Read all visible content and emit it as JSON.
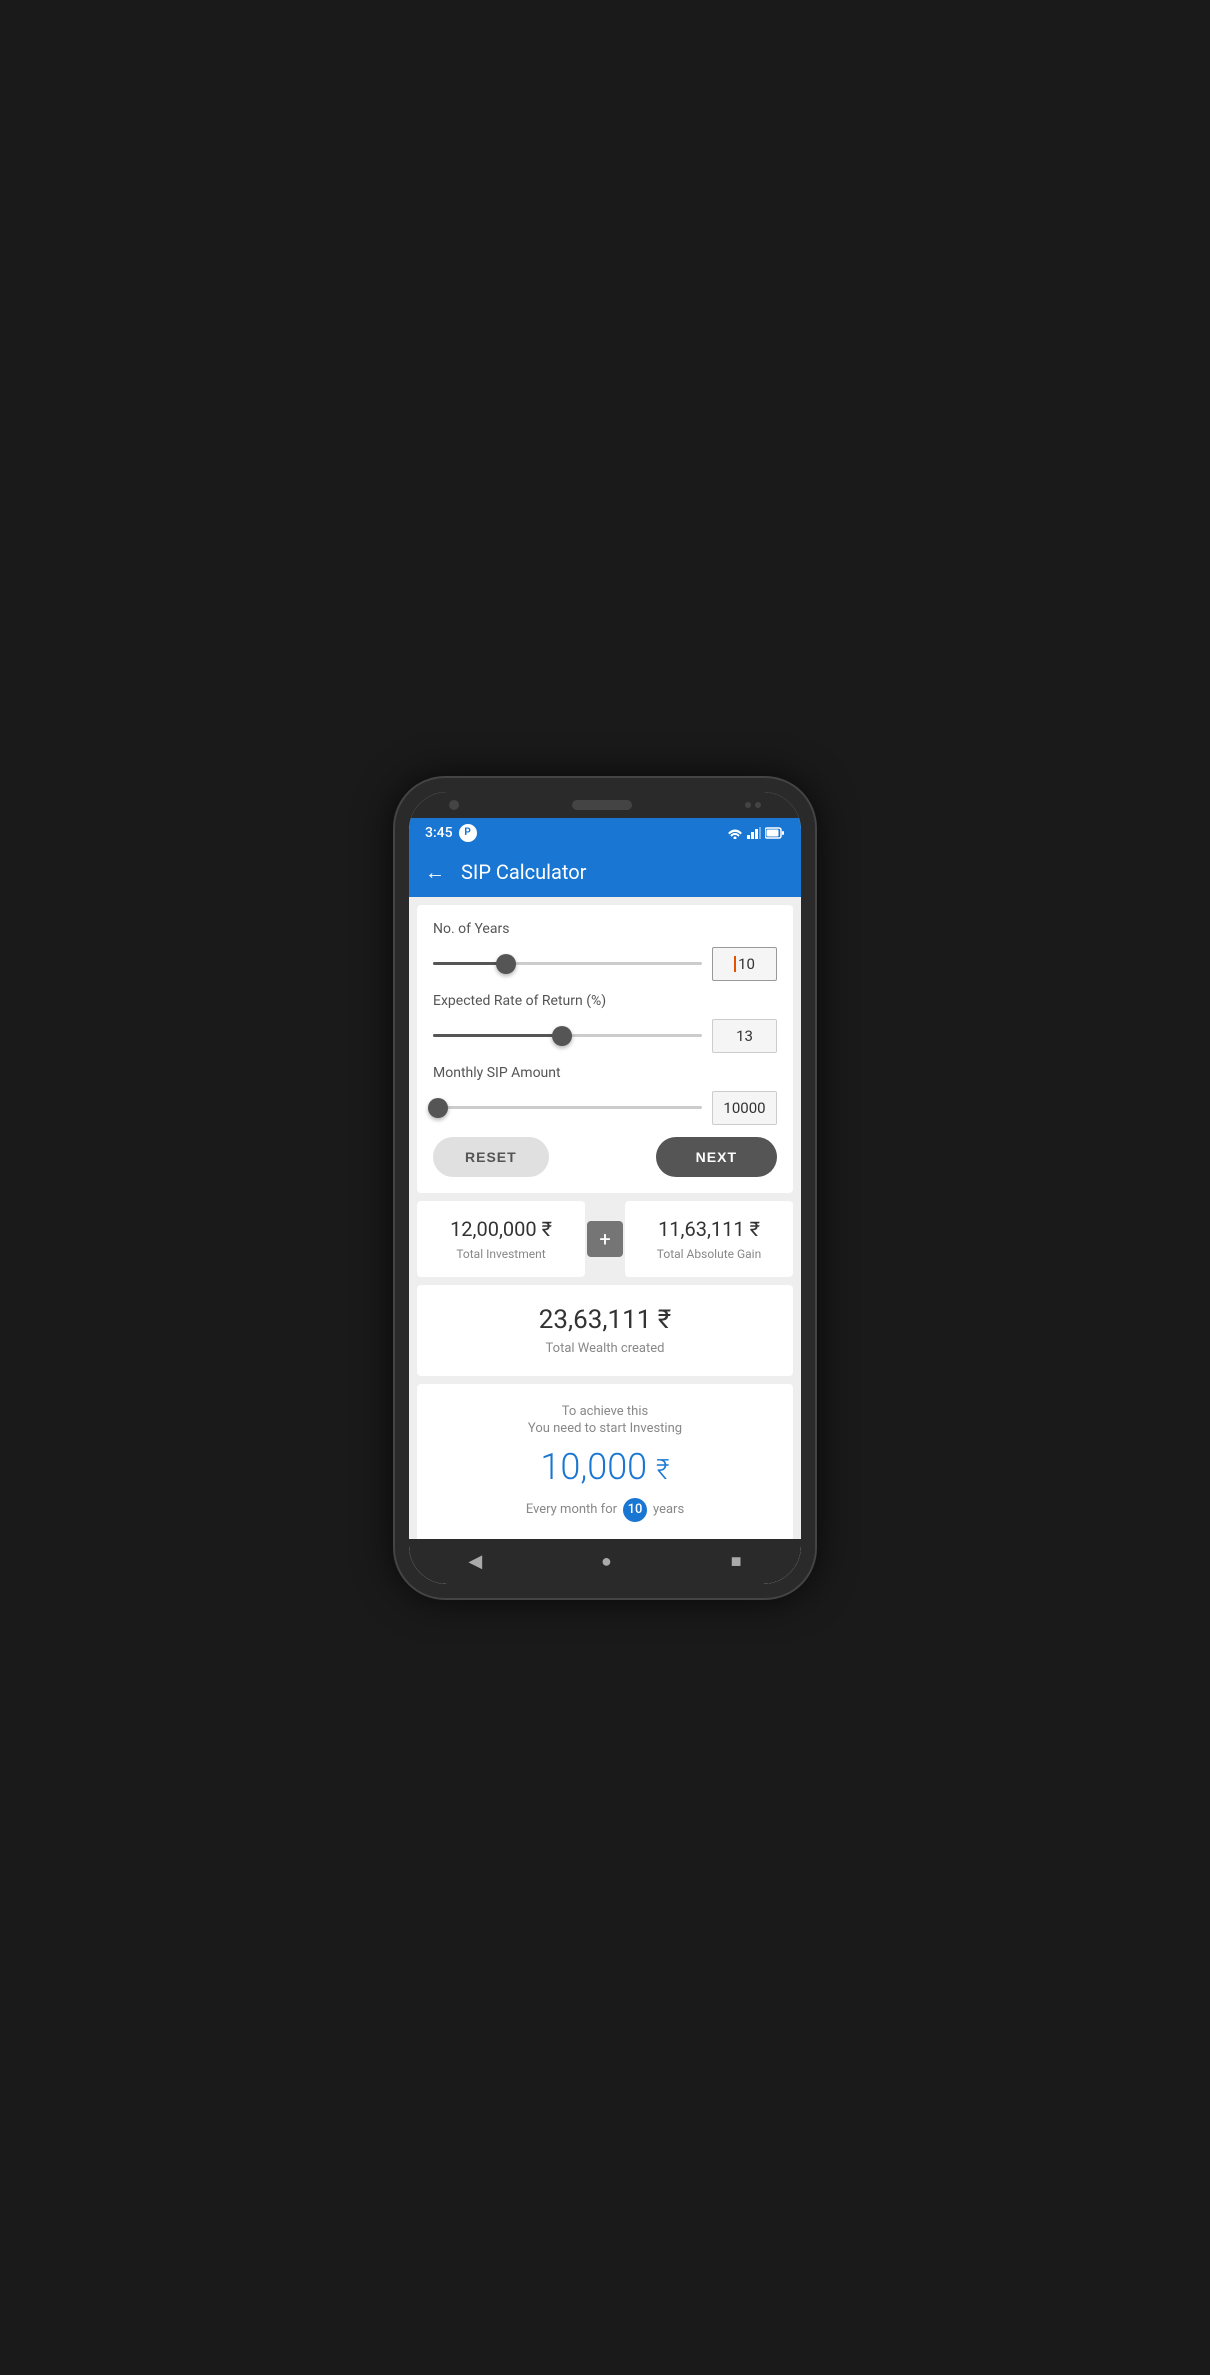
{
  "status_bar": {
    "time": "3:45",
    "p_label": "P",
    "wifi": "▾▴",
    "signal": "▲",
    "battery": "▮"
  },
  "app_bar": {
    "back_icon": "←",
    "title": "SIP Calculator"
  },
  "sliders": {
    "years": {
      "label": "No. of Years",
      "value": "10",
      "fill_pct": 27,
      "thumb_pct": 27
    },
    "rate": {
      "label": "Expected Rate of Return (%)",
      "value": "13",
      "fill_pct": 48,
      "thumb_pct": 48
    },
    "sip": {
      "label": "Monthly SIP Amount",
      "value": "10000",
      "fill_pct": 2,
      "thumb_pct": 2
    }
  },
  "buttons": {
    "reset": "RESET",
    "next": "NEXT"
  },
  "results": {
    "total_investment": {
      "amount": "12,00,000 ₹",
      "label": "Total Investment"
    },
    "plus_icon": "+",
    "total_gain": {
      "amount": "11,63,111 ₹",
      "label": "Total Absolute Gain"
    },
    "total_wealth": {
      "amount": "23,63,111 ₹",
      "label": "Total Wealth created"
    }
  },
  "achieve": {
    "line1": "To achieve this",
    "line2": "You need to start Investing",
    "amount": "10,000",
    "currency": "₹",
    "footer_prefix": "Every month for",
    "years_value": "10",
    "footer_suffix": "years"
  },
  "nav": {
    "back": "◀",
    "home": "●",
    "recent": "■"
  }
}
